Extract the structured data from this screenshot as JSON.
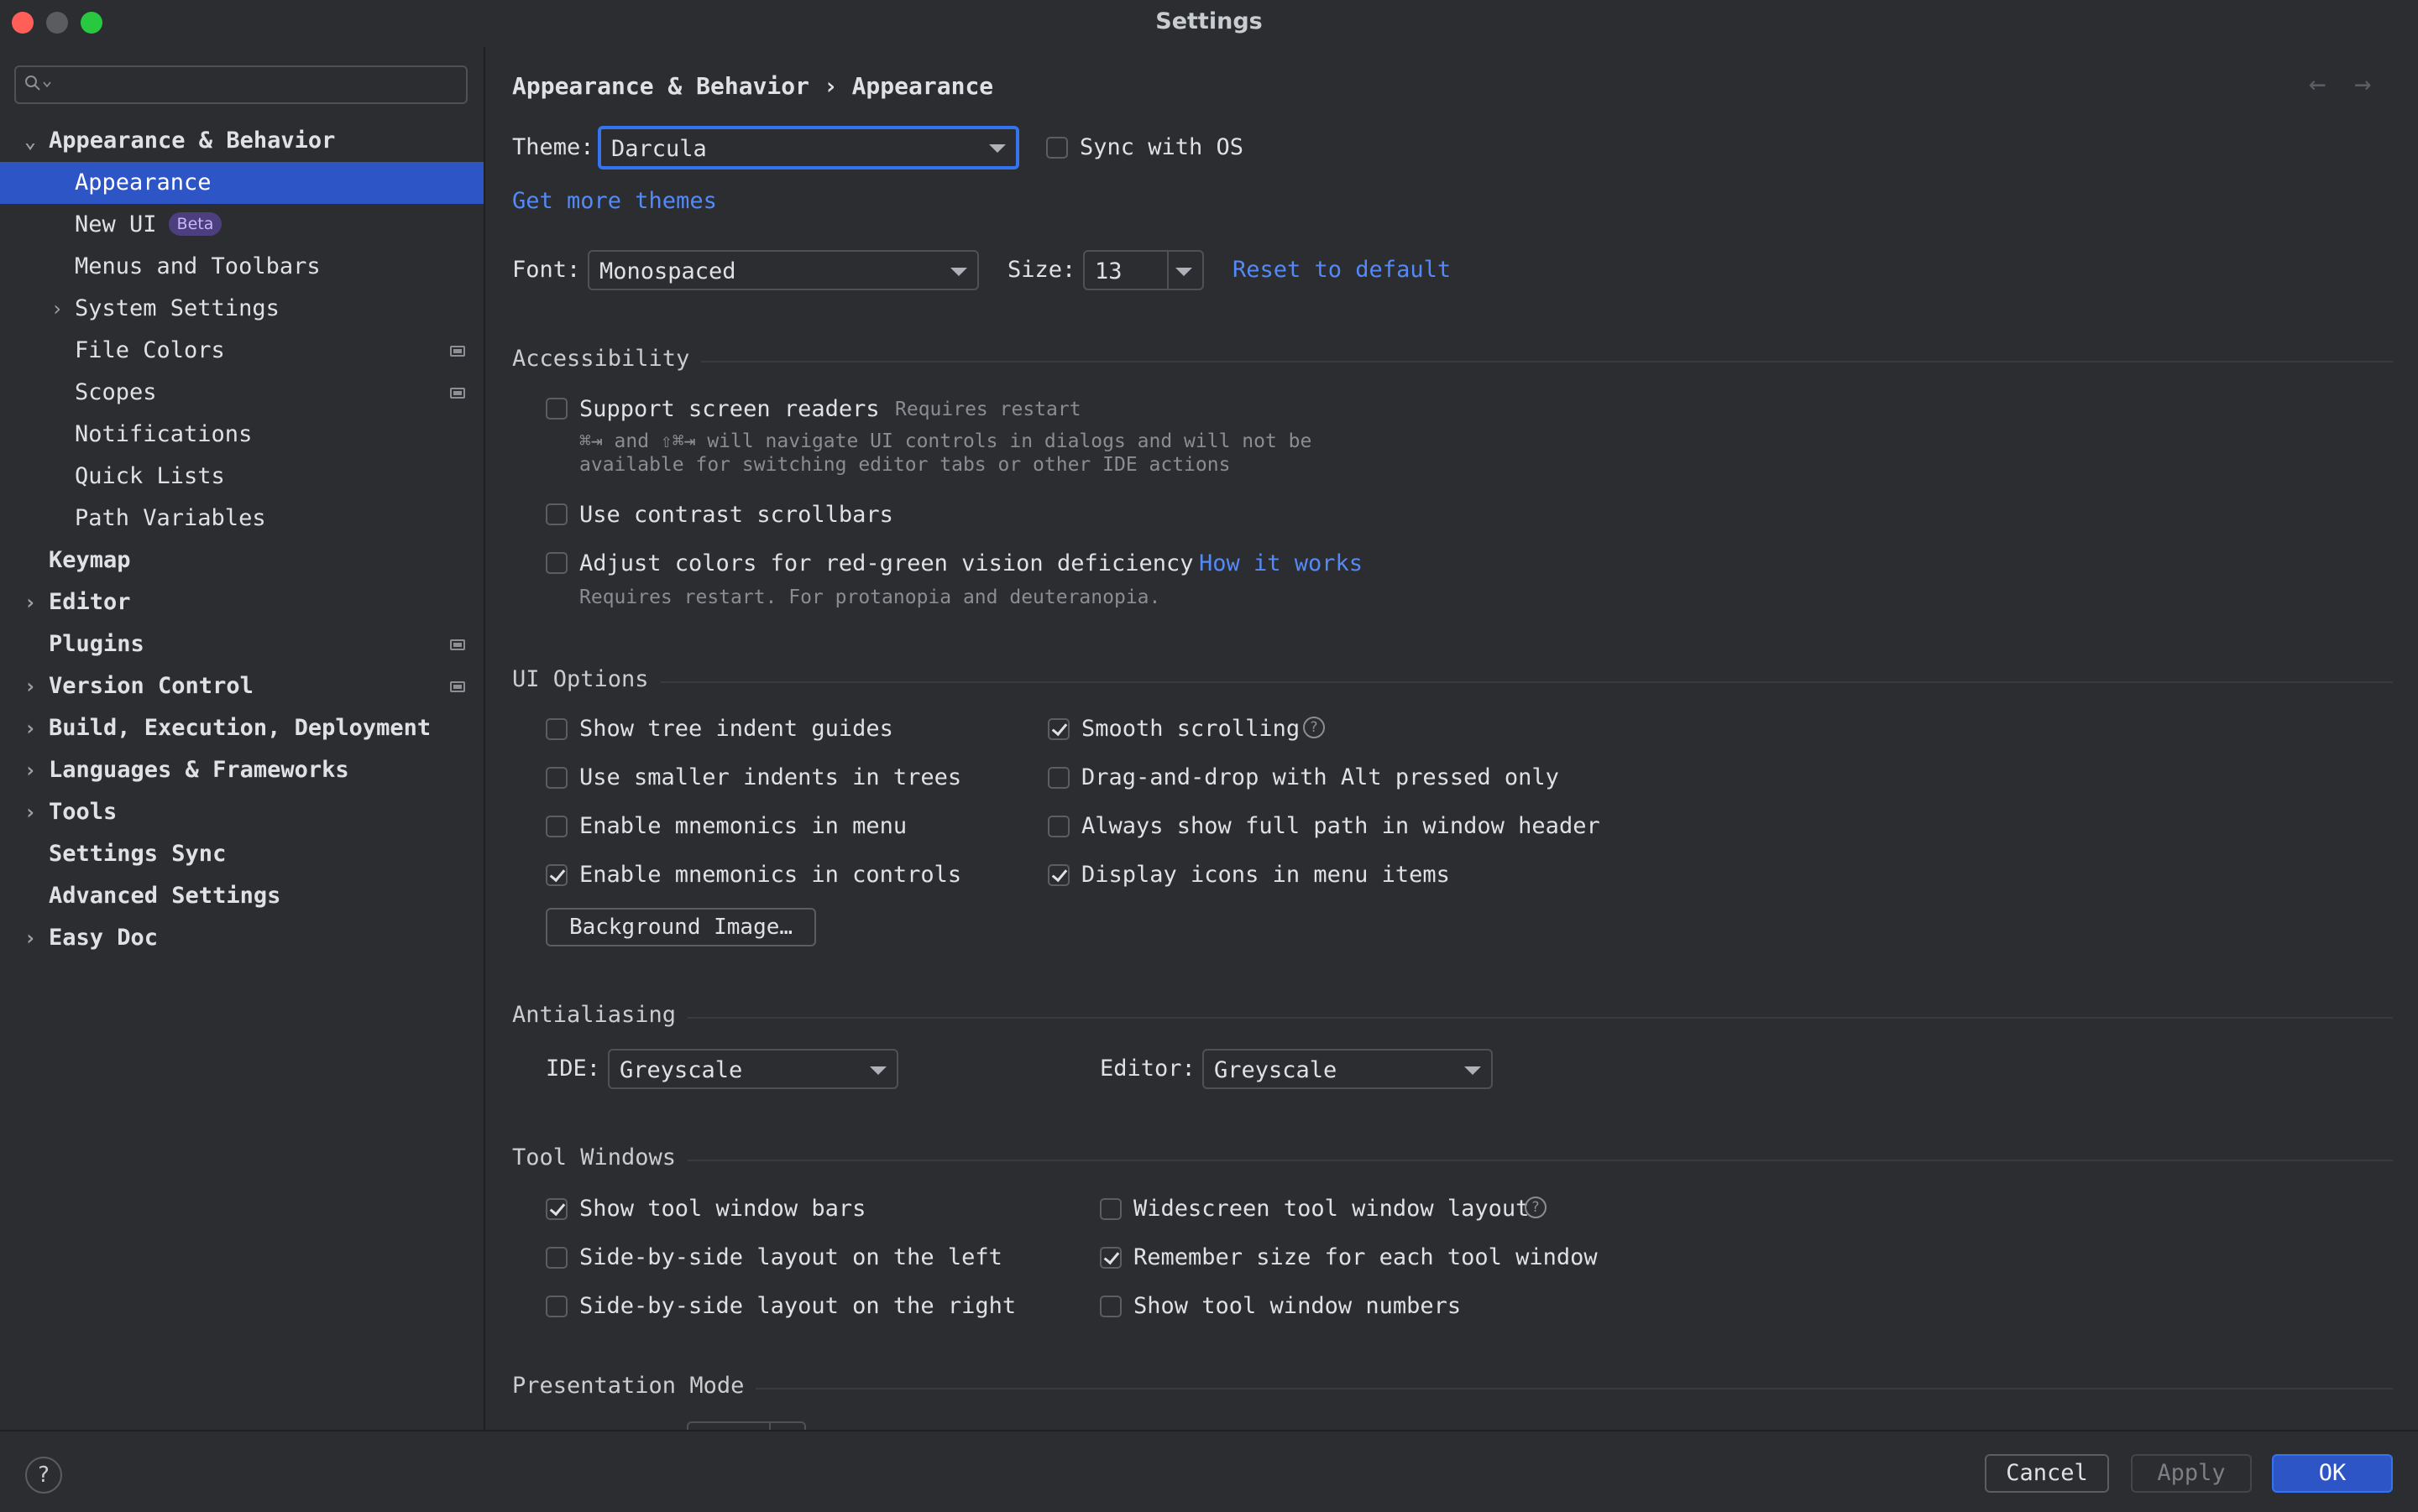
{
  "window": {
    "title": "Settings"
  },
  "sidebar": {
    "search_placeholder": "",
    "items": [
      {
        "label": "Appearance & Behavior",
        "expanded": true
      },
      {
        "label": "Appearance",
        "selected": true
      },
      {
        "label": "New UI",
        "badge": "Beta"
      },
      {
        "label": "Menus and Toolbars"
      },
      {
        "label": "System Settings"
      },
      {
        "label": "File Colors"
      },
      {
        "label": "Scopes"
      },
      {
        "label": "Notifications"
      },
      {
        "label": "Quick Lists"
      },
      {
        "label": "Path Variables"
      },
      {
        "label": "Keymap"
      },
      {
        "label": "Editor"
      },
      {
        "label": "Plugins"
      },
      {
        "label": "Version Control"
      },
      {
        "label": "Build, Execution, Deployment"
      },
      {
        "label": "Languages & Frameworks"
      },
      {
        "label": "Tools"
      },
      {
        "label": "Settings Sync"
      },
      {
        "label": "Advanced Settings"
      },
      {
        "label": "Easy Doc"
      }
    ]
  },
  "main": {
    "breadcrumb": "Appearance & Behavior › Appearance",
    "nav_back": "←",
    "nav_forward": "→",
    "theme": {
      "label": "Theme:",
      "value": "Darcula",
      "sync_label": "Sync with OS",
      "sync_checked": false
    },
    "get_more_themes": "Get more themes",
    "font": {
      "label": "Font:",
      "value": "Monospaced",
      "size_label": "Size:",
      "size_value": "13",
      "reset_label": "Reset to default"
    },
    "accessibility": {
      "title": "Accessibility",
      "screen_readers": {
        "label": "Support screen readers",
        "checked": false,
        "hint": "Requires restart",
        "note_1": "⌘⇥ and ⇧⌘⇥ will navigate UI controls in dialogs and will not be",
        "note_2": "available for switching editor tabs or other IDE actions"
      },
      "contrast_scrollbars": {
        "label": "Use contrast scrollbars",
        "checked": false
      },
      "color_deficiency": {
        "label": "Adjust colors for red-green vision deficiency",
        "checked": false,
        "link": "How it works",
        "note": "Requires restart. For protanopia and deuteranopia."
      }
    },
    "ui_options": {
      "title": "UI Options",
      "left": [
        {
          "label": "Show tree indent guides",
          "checked": false
        },
        {
          "label": "Use smaller indents in trees",
          "checked": false
        },
        {
          "label": "Enable mnemonics in menu",
          "checked": false
        },
        {
          "label": "Enable mnemonics in controls",
          "checked": true
        }
      ],
      "right": [
        {
          "label": "Smooth scrolling",
          "checked": true
        },
        {
          "label": "Drag-and-drop with Alt pressed only",
          "checked": false
        },
        {
          "label": "Always show full path in window header",
          "checked": false
        },
        {
          "label": "Display icons in menu items",
          "checked": true
        }
      ],
      "background_button": "Background Image…"
    },
    "antialiasing": {
      "title": "Antialiasing",
      "ide_label": "IDE:",
      "ide_value": "Greyscale",
      "editor_label": "Editor:",
      "editor_value": "Greyscale"
    },
    "tool_windows": {
      "title": "Tool Windows",
      "left": [
        {
          "label": "Show tool window bars",
          "checked": true
        },
        {
          "label": "Side-by-side layout on the left",
          "checked": false
        },
        {
          "label": "Side-by-side layout on the right",
          "checked": false
        }
      ],
      "right": [
        {
          "label": "Widescreen tool window layout",
          "checked": false
        },
        {
          "label": "Remember size for each tool window",
          "checked": true
        },
        {
          "label": "Show tool window numbers",
          "checked": false
        }
      ]
    },
    "presentation_mode": {
      "title": "Presentation Mode"
    }
  },
  "footer": {
    "help": "?",
    "cancel": "Cancel",
    "apply": "Apply",
    "ok": "OK"
  },
  "colors": {
    "accent": "#2e55c5",
    "link": "#548af7",
    "background": "#2b2d30",
    "badge": "#4d3e7d"
  }
}
